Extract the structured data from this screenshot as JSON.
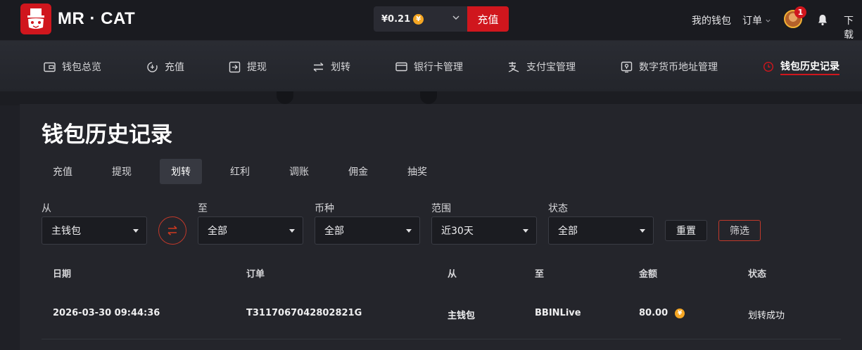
{
  "header": {
    "logo_text": "MR · CAT",
    "balance": "¥0.21",
    "coin_symbol": "¥",
    "recharge_label": "充值",
    "my_wallet": "我的钱包",
    "orders": "订单",
    "notification_count": "1",
    "download": "下载"
  },
  "subnav": {
    "items": [
      {
        "label": "钱包总览",
        "icon": "wallet-icon"
      },
      {
        "label": "充值",
        "icon": "deposit-icon"
      },
      {
        "label": "提现",
        "icon": "withdraw-icon"
      },
      {
        "label": "划转",
        "icon": "transfer-icon"
      },
      {
        "label": "银行卡管理",
        "icon": "bank-card-icon"
      },
      {
        "label": "支付宝管理",
        "icon": "alipay-icon"
      },
      {
        "label": "数字货币地址管理",
        "icon": "crypto-address-icon"
      },
      {
        "label": "钱包历史记录",
        "icon": "history-clock-icon"
      }
    ],
    "active_index": 7
  },
  "page": {
    "title": "钱包历史记录",
    "tabs": [
      "充值",
      "提现",
      "划转",
      "红利",
      "调账",
      "佣金",
      "抽奖"
    ],
    "active_tab": "划转"
  },
  "filters": {
    "from_label": "从",
    "from_value": "主钱包",
    "to_label": "至",
    "to_value": "全部",
    "currency_label": "币种",
    "currency_value": "全部",
    "range_label": "范围",
    "range_value": "近30天",
    "status_label": "状态",
    "status_value": "全部",
    "reset_label": "重置",
    "filter_label": "筛选"
  },
  "table": {
    "headers": [
      "日期",
      "订单",
      "从",
      "至",
      "金额",
      "状态"
    ],
    "rows": [
      {
        "date": "2026-03-30 09:44:36",
        "order": "T3117067042802821G",
        "from": "主钱包",
        "to": "BBINLive",
        "amount": "80.00",
        "status": "划转成功"
      }
    ]
  },
  "colors": {
    "accent": "#d0161d",
    "coin": "#f5a623",
    "background": "#1f2026",
    "panel": "#24252b"
  }
}
